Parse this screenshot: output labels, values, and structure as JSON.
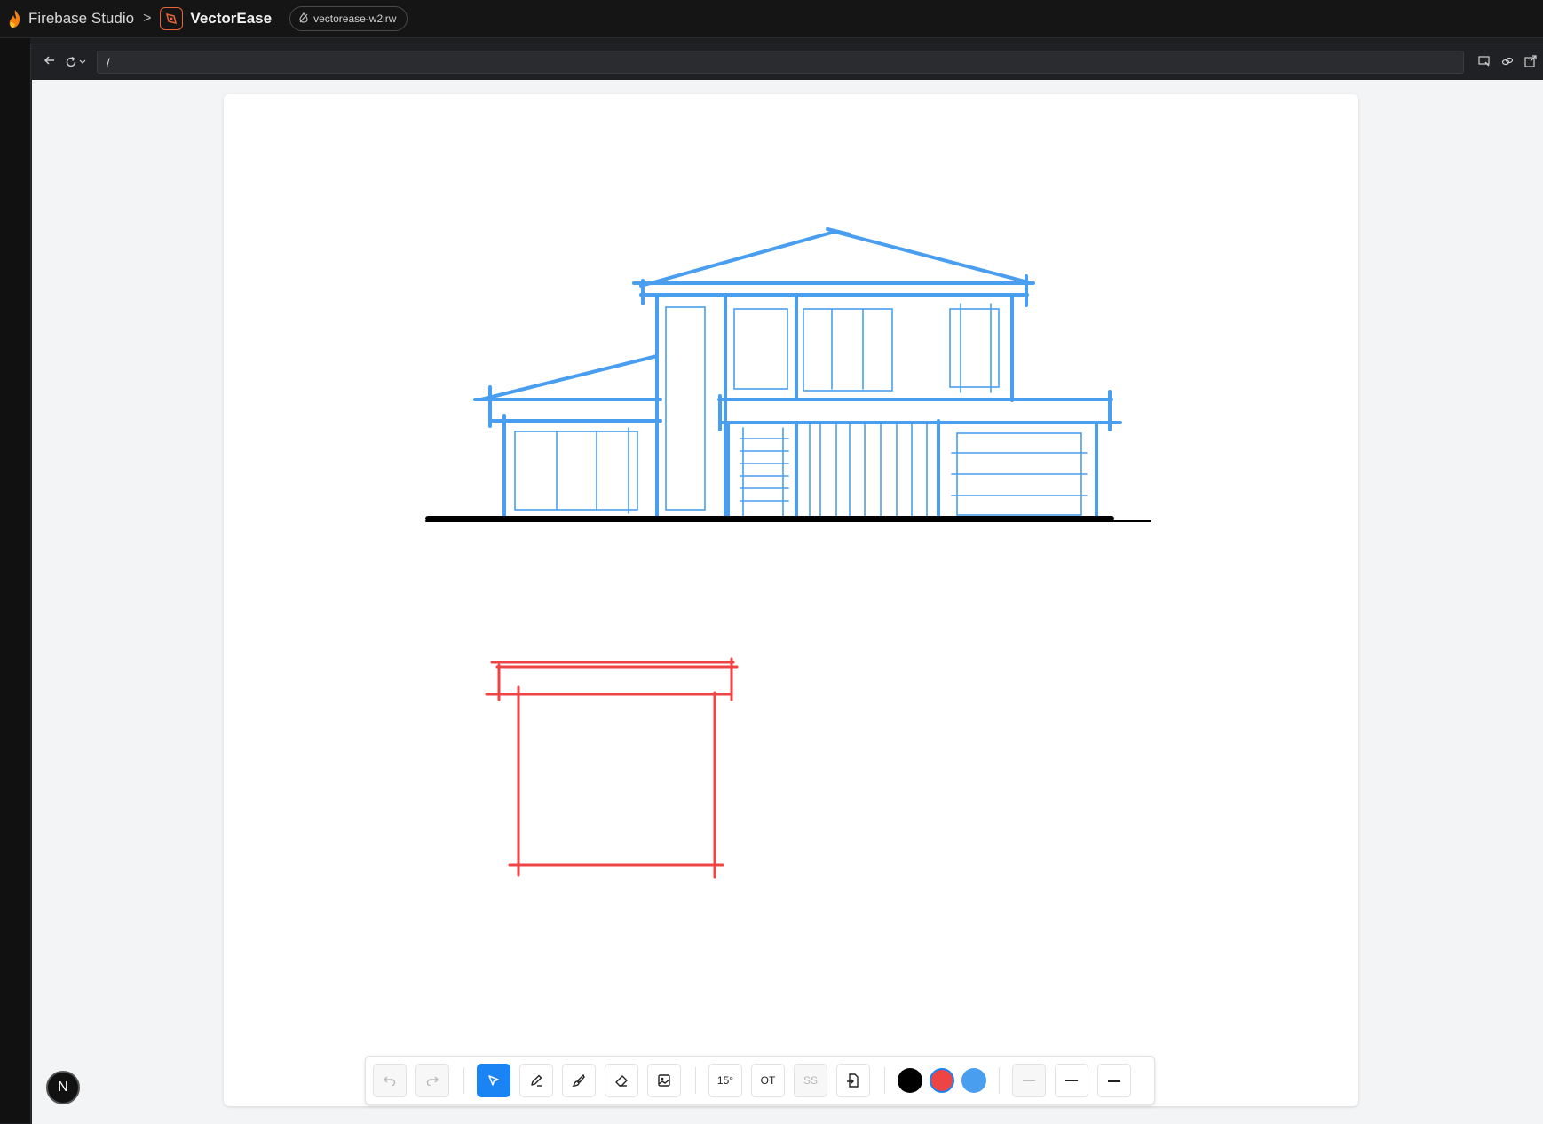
{
  "topbar": {
    "studio_label": "Firebase Studio",
    "separator": ">",
    "app_name": "VectorEase",
    "workspace_label": "vectorease-w2irw"
  },
  "browser": {
    "url_value": "/",
    "back_icon": "arrow-left-icon",
    "reload_icon": "reload-icon"
  },
  "toolbar": {
    "undo_icon": "undo-icon",
    "redo_icon": "redo-icon",
    "select_icon": "cursor-arrow-icon",
    "pen_icon": "pen-icon",
    "brush_icon": "brush-icon",
    "eraser_icon": "eraser-icon",
    "image_icon": "image-icon",
    "snap_angle_label": "15°",
    "ot_label": "OT",
    "ss_label": "SS",
    "export_icon": "file-export-icon",
    "colors": [
      {
        "name": "black",
        "hex": "#000000",
        "selected": false
      },
      {
        "name": "red",
        "hex": "#ef4444",
        "selected": true
      },
      {
        "name": "blue",
        "hex": "#4a9eef",
        "selected": false
      }
    ],
    "stroke_widths": [
      "thin",
      "medium",
      "thick"
    ],
    "active_stroke": "thin"
  },
  "badge": {
    "label": "N"
  },
  "colors": {
    "accent": "#1a84f5",
    "sketch_blue": "#4a9eef",
    "sketch_red": "#ef4444",
    "ground_black": "#000000"
  }
}
